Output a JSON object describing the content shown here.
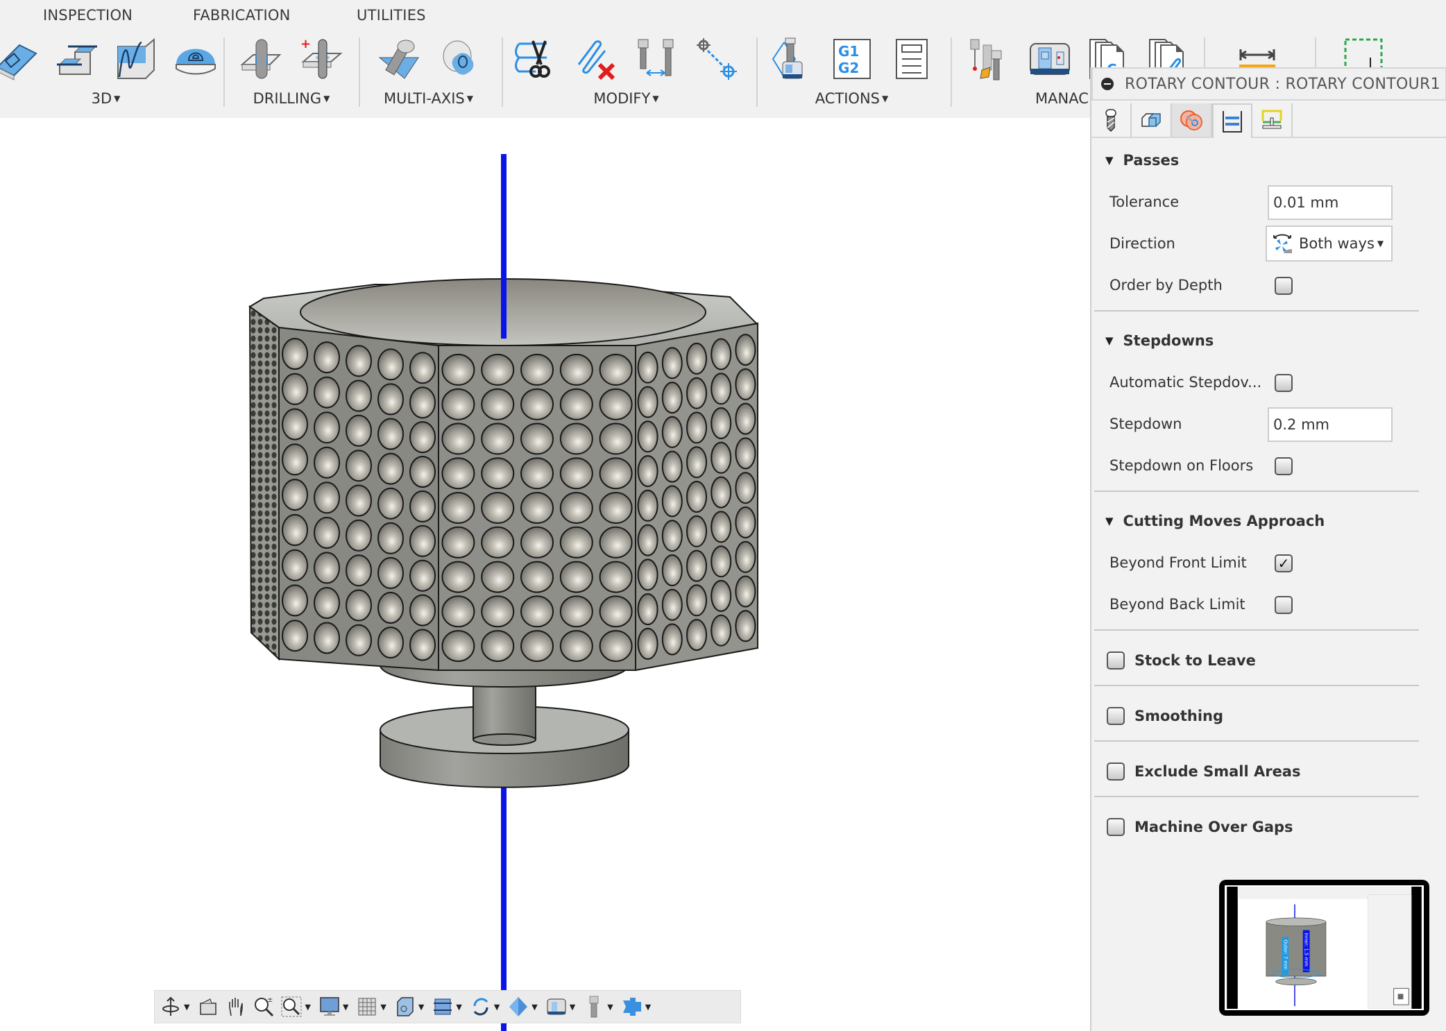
{
  "toolbar": {
    "top_tabs": [
      "INSPECTION",
      "FABRICATION",
      "UTILITIES"
    ],
    "groups": [
      {
        "label": "3D",
        "has_dropdown": true,
        "icons": [
          "pocket-3d-icon",
          "horizontal-3d-icon",
          "parallel-3d-icon",
          "scallop-3d-icon"
        ]
      },
      {
        "label": "DRILLING",
        "has_dropdown": true,
        "icons": [
          "drill-icon",
          "hole-recognition-icon"
        ]
      },
      {
        "label": "MULTI-AXIS",
        "has_dropdown": true,
        "icons": [
          "swarf-icon",
          "multi-axis-contour-icon"
        ]
      },
      {
        "label": "MODIFY",
        "has_dropdown": true,
        "icons": [
          "trim-toolpath-icon",
          "delete-toolpath-icon",
          "tool-compare-icon",
          "path-edit-icon"
        ]
      },
      {
        "label": "ACTIONS",
        "has_dropdown": true,
        "icons": [
          "simulate-icon",
          "post-process-icon",
          "setup-sheet-icon"
        ]
      },
      {
        "label": "MANAGE",
        "has_dropdown": false,
        "icons": [
          "tool-library-icon",
          "machine-library-icon",
          "post-library-icon",
          "template-library-icon"
        ]
      },
      {
        "label": "",
        "has_dropdown": false,
        "icons": [
          "measure-icon"
        ]
      },
      {
        "label": "",
        "has_dropdown": false,
        "icons": [
          "select-icon"
        ]
      }
    ],
    "visible_manage_label": "MANAC",
    "caret": "▼"
  },
  "panel": {
    "title": "ROTARY CONTOUR : ROTARY CONTOUR1",
    "tabs": [
      {
        "name": "tool-tab",
        "icon": "tool-icon",
        "state": "normal"
      },
      {
        "name": "geometry-tab",
        "icon": "geometry-icon",
        "state": "normal"
      },
      {
        "name": "radii-tab",
        "icon": "radii-icon",
        "state": "hover"
      },
      {
        "name": "passes-tab",
        "icon": "passes-icon",
        "state": "active"
      },
      {
        "name": "linking-tab",
        "icon": "linking-icon",
        "state": "normal"
      }
    ],
    "sections": {
      "passes": {
        "title": "Passes",
        "expanded": true,
        "tolerance_label": "Tolerance",
        "tolerance_value": "0.01 mm",
        "direction_label": "Direction",
        "direction_value": "Both ways",
        "order_by_depth_label": "Order by Depth",
        "order_by_depth_checked": false
      },
      "stepdowns": {
        "title": "Stepdowns",
        "expanded": true,
        "automatic_label": "Automatic Stepdov...",
        "automatic_checked": false,
        "stepdown_label": "Stepdown",
        "stepdown_value": "0.2 mm",
        "stepdown_on_floors_label": "Stepdown on Floors",
        "stepdown_on_floors_checked": false
      },
      "cutting_moves": {
        "title": "Cutting Moves Approach",
        "expanded": true,
        "front_label": "Beyond Front Limit",
        "front_checked": true,
        "back_label": "Beyond Back Limit",
        "back_checked": false
      },
      "stock_to_leave": {
        "title": "Stock to Leave",
        "checked": false
      },
      "smoothing": {
        "title": "Smoothing",
        "checked": false
      },
      "exclude_small_areas": {
        "title": "Exclude Small Areas",
        "checked": false
      },
      "machine_over_gaps": {
        "title": "Machine Over Gaps",
        "checked": false
      }
    },
    "triangle": "▼",
    "check_mark": "✓"
  },
  "navbar": {
    "items": [
      {
        "icon": "orbit-icon",
        "dropdown": true
      },
      {
        "icon": "look-at-icon",
        "dropdown": false
      },
      {
        "icon": "pan-hand-icon",
        "dropdown": false
      },
      {
        "icon": "zoom-icon",
        "dropdown": false
      },
      {
        "icon": "zoom-window-icon",
        "dropdown": true
      },
      {
        "icon": "display-settings-icon",
        "dropdown": true
      },
      {
        "icon": "grid-icon",
        "dropdown": true
      },
      {
        "icon": "viewports-icon",
        "dropdown": true
      },
      {
        "icon": "toolpath-display-icon",
        "dropdown": true
      },
      {
        "icon": "simulation-cycle-icon",
        "dropdown": true
      },
      {
        "icon": "stock-display-icon",
        "dropdown": true
      },
      {
        "icon": "machine-display-icon",
        "dropdown": true
      },
      {
        "icon": "tool-display-icon",
        "dropdown": true
      },
      {
        "icon": "fixture-display-icon",
        "dropdown": true
      }
    ],
    "caret": "▼"
  },
  "viewport": {
    "axis_color": "#0a14e6",
    "model_face_color": "#8a8a84",
    "model_top_color": "#b9bcb6",
    "dimple_rows": 9,
    "dimple_cols_per_face": 5
  },
  "thumbnail": {
    "labels": [
      "Outer: 7 mm",
      "Inner: 1.5 mm"
    ],
    "label_colors": [
      "#1e9be8",
      "#0a14e6"
    ]
  }
}
